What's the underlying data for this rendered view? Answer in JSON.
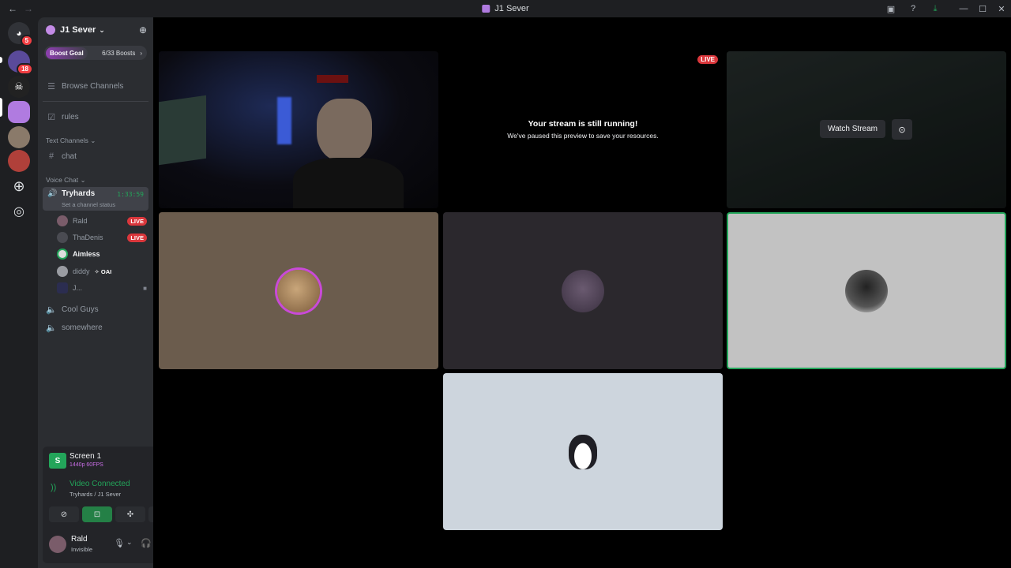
{
  "titlebar": {
    "back_icon": "arrow-left-icon",
    "forward_icon": "arrow-right-icon",
    "title": "J1 Sever",
    "minimize": "—",
    "maximize": "☐",
    "close": "✕"
  },
  "rail": {
    "home_badge": "5",
    "server1_badge": "18"
  },
  "sidebar": {
    "server_name": "J1 Sever",
    "boost_label": "Boost Goal",
    "boost_count": "6/33 Boosts",
    "browse_channels": "Browse Channels",
    "rules": "rules",
    "text_category": "Text Channels",
    "chat": "chat",
    "voice_category": "Voice Chat",
    "active_voice": {
      "name": "Tryhards",
      "timer": "1:33:59",
      "status": "Set a channel status"
    },
    "voice_users": [
      {
        "name": "Rald",
        "live": "LIVE"
      },
      {
        "name": "ThaDenis",
        "live": "LIVE"
      },
      {
        "name": "Aimless"
      },
      {
        "name": "diddy",
        "tag": "OAI"
      },
      {
        "name": "J..."
      }
    ],
    "other_voice": [
      "Cool Guys",
      "somewhere"
    ]
  },
  "panel": {
    "screen_title": "Screen 1",
    "screen_quality": "1440p 60FPS",
    "vc_title": "Video Connected",
    "vc_location": "Tryhards / J1 Sever",
    "user_name": "Rald",
    "user_status": "Invisible"
  },
  "stage": {
    "live_badge": "LIVE",
    "paused_title": "Your stream is still running!",
    "paused_sub": "We've paused this preview to save your resources.",
    "watch_stream": "Watch Stream"
  },
  "colors": {
    "green": "#23a55a",
    "red": "#da373c",
    "accent": "#5865f2"
  }
}
